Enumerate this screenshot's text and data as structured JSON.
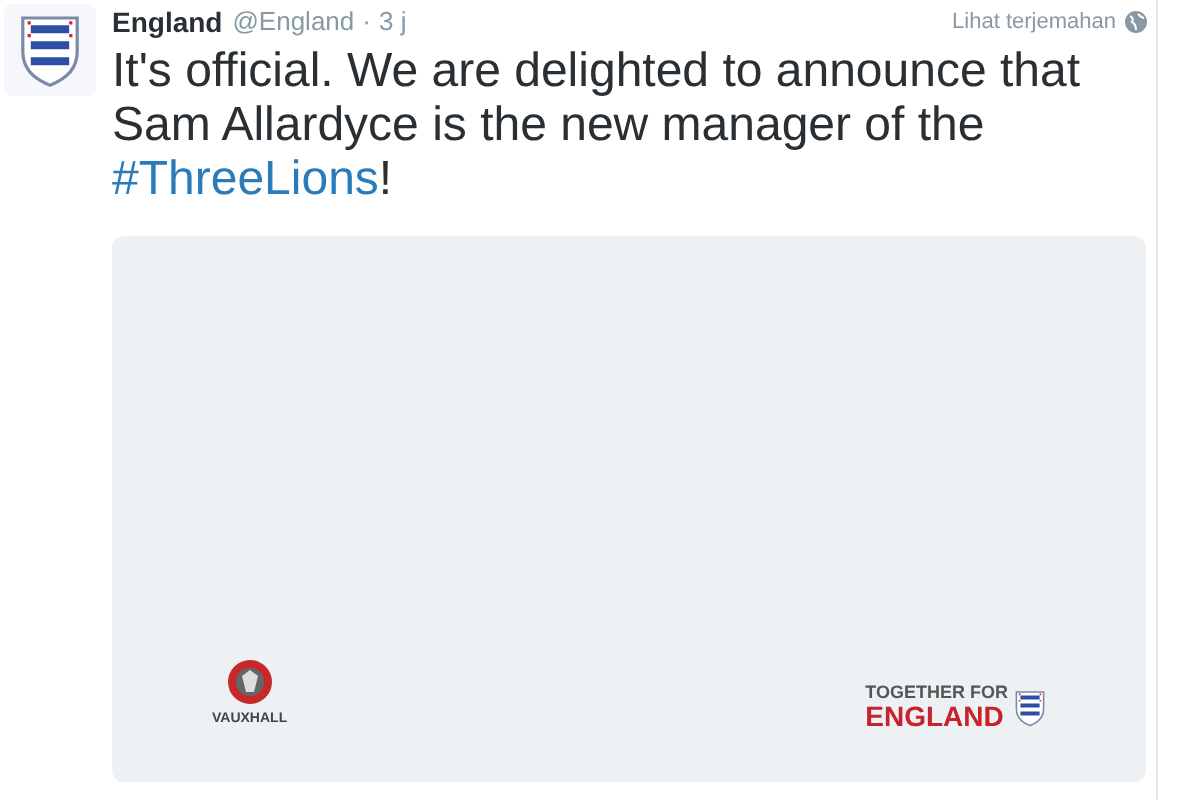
{
  "tweet": {
    "author": "England",
    "handle": "@England",
    "separator": "·",
    "time": "3 j",
    "translate": "Lihat terjemahan",
    "text": "It's official. We are delighted to announce that Sam Allardyce is the new manager of the ",
    "hashtag": "#ThreeLions",
    "text_end": "!",
    "media": {
      "sponsor": "VAUXHALL",
      "slogan_top": "TOGETHER FOR",
      "slogan_bottom": "ENGLAND"
    }
  }
}
